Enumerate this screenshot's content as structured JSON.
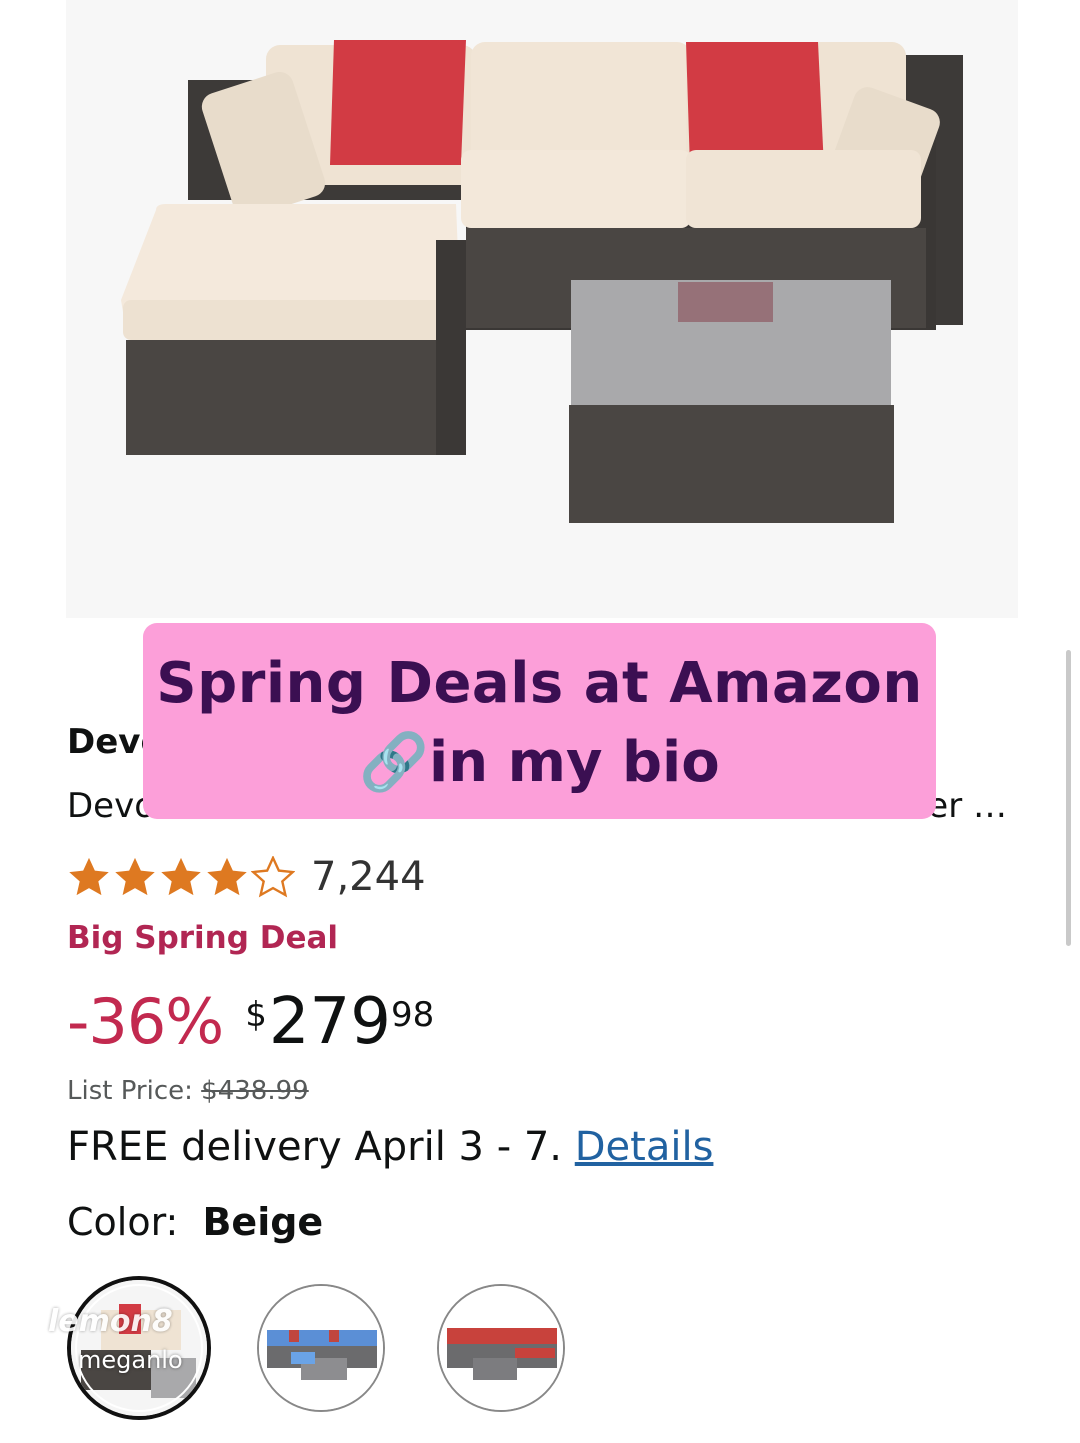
{
  "product": {
    "brand": "Devo",
    "title": "Devo",
    "title_ellipsis": "er …",
    "rating": 4.5,
    "review_count": "7,244",
    "deal_label": "Big Spring Deal",
    "discount": "-36%",
    "price": {
      "currency": "$",
      "whole": "279",
      "fraction": "98"
    },
    "list_price_label": "List Price:",
    "list_price": "$438.99",
    "delivery_text": "FREE delivery April 3 - 7.",
    "delivery_link": "Details",
    "color_label": "Color:",
    "color_value": "Beige",
    "swatches": [
      {
        "name": "Beige",
        "selected": true
      },
      {
        "name": "Blue",
        "selected": false
      },
      {
        "name": "Red",
        "selected": false
      }
    ]
  },
  "overlay": {
    "line1": "Spring Deals at Amazon",
    "icon": "link-icon",
    "line2": "in my bio"
  },
  "watermark": {
    "brand": "lemon8",
    "user": "meganlo"
  },
  "colors": {
    "overlay_bg": "#fc9fd9",
    "overlay_text": "#3b0f52",
    "deal": "#b12653",
    "discount": "#c2294f",
    "star": "#de7921",
    "link": "#2162a1"
  }
}
